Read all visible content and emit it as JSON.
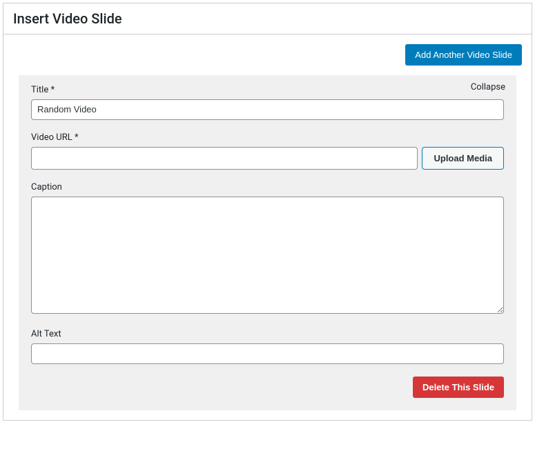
{
  "header": {
    "title": "Insert Video Slide"
  },
  "actions": {
    "add_another": "Add Another Video Slide"
  },
  "panel": {
    "collapse_label": "Collapse",
    "fields": {
      "title": {
        "label": "Title *",
        "value": "Random Video"
      },
      "video_url": {
        "label": "Video URL *",
        "value": "",
        "upload_button": "Upload Media"
      },
      "caption": {
        "label": "Caption",
        "value": ""
      },
      "alt_text": {
        "label": "Alt Text",
        "value": ""
      }
    },
    "delete_button": "Delete This Slide"
  }
}
